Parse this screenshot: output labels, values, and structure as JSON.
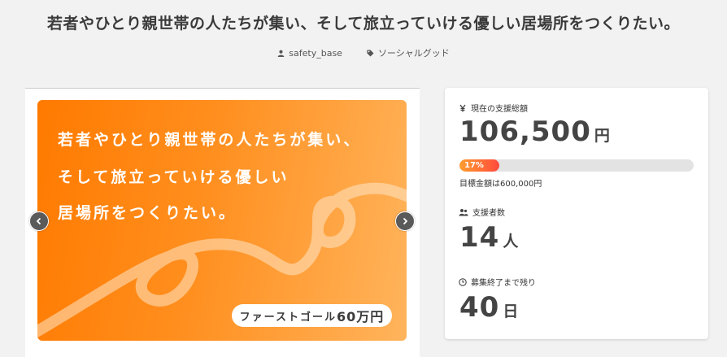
{
  "project": {
    "title": "若者やひとり親世帯の人たちが集い、そして旅立っていける優しい居場所をつくりたい。",
    "author": "safety_base",
    "category": "ソーシャルグッド"
  },
  "slide": {
    "line1": "若者やひとり親世帯の人たちが集い、",
    "line2": "そして旅立っていける優しい",
    "line3": "居場所をつくりたい。",
    "goal_label": "ファーストゴール",
    "goal_amount": "60万円"
  },
  "stats": {
    "raised_label": "現在の支援総額",
    "raised_value": "106,500",
    "raised_unit": "円",
    "progress_percent": 17,
    "progress_label": "17%",
    "goal_text": "目標金額は600,000円",
    "supporters_label": "支援者数",
    "supporters_value": "14",
    "supporters_unit": "人",
    "remaining_label": "募集終了まで残り",
    "remaining_value": "40",
    "remaining_unit": "日"
  },
  "icons": {
    "yen": "yen-icon",
    "users": "users-icon",
    "clock": "clock-icon",
    "user": "user-icon",
    "tag": "tag-icon"
  }
}
